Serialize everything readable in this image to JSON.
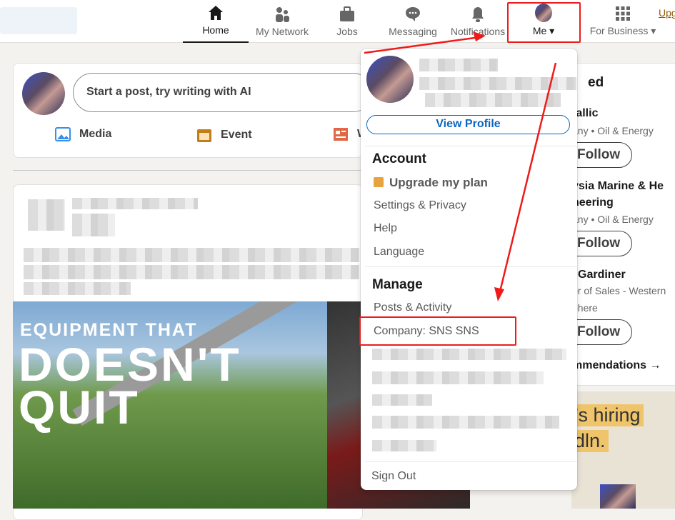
{
  "header": {
    "nav": [
      {
        "label": "Home",
        "icon": "home-icon",
        "active": true
      },
      {
        "label": "My Network",
        "icon": "people-icon"
      },
      {
        "label": "Jobs",
        "icon": "briefcase-icon"
      },
      {
        "label": "Messaging",
        "icon": "chat-icon"
      },
      {
        "label": "Notifications",
        "icon": "bell-icon"
      },
      {
        "label": "Me",
        "icon": "avatar"
      },
      {
        "label": "For Business",
        "icon": "grid-icon"
      }
    ],
    "upgrade_partial": "Upg"
  },
  "feed": {
    "start_post": "Start a post, try writing with AI",
    "actions": [
      {
        "label": "Media",
        "color": "#378fe9"
      },
      {
        "label": "Event",
        "color": "#c37d16"
      },
      {
        "label": "W",
        "color": "#e06847"
      }
    ],
    "ad": {
      "line1": "EQUIPMENT THAT",
      "line2": "DOESN'T",
      "line3": "QUIT"
    }
  },
  "right_panel": {
    "title_partial": "ed",
    "items": [
      {
        "name": "tallic",
        "subtitle": "any • Oil & Energy",
        "button": "Follow"
      },
      {
        "name": "ysia Marine & He",
        "name2": "neering",
        "subtitle": "any • Oil & Energy",
        "button": "Follow"
      },
      {
        "name": "Gardiner",
        "subtitle": "or of Sales - Western",
        "subtitle2": "phere",
        "button": "Follow"
      }
    ],
    "recommendations": "mmendations →",
    "hiring_ad": {
      "line1": "’s hiring",
      "line2": "dln."
    }
  },
  "me_menu": {
    "view_profile": "View Profile",
    "account_heading": "Account",
    "account_items": [
      "Upgrade my plan",
      "Settings & Privacy",
      "Help",
      "Language"
    ],
    "premium_color": "#e7a33e",
    "manage_heading": "Manage",
    "manage_items": [
      "Posts & Activity",
      "Company: SNS SNS"
    ],
    "sign_out": "Sign Out"
  },
  "annotation_color": "#f01a1a"
}
